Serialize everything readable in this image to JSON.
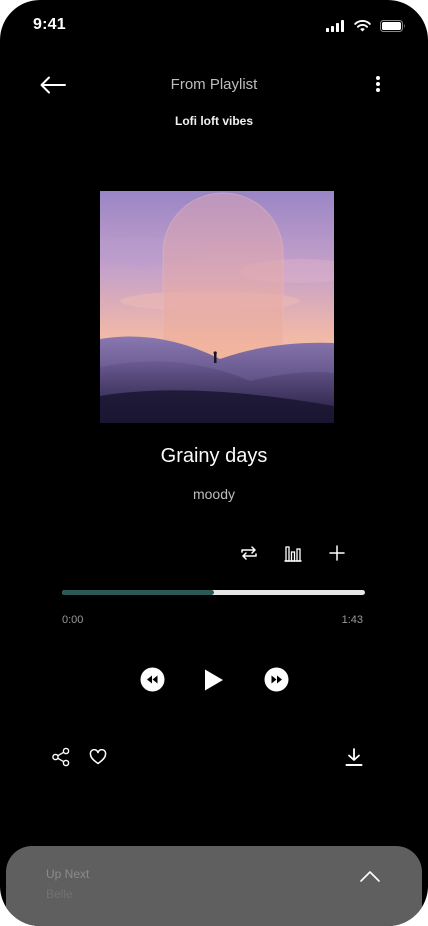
{
  "status_bar": {
    "time": "9:41",
    "icons": [
      "cellular-signal-icon",
      "wifi-icon",
      "battery-icon"
    ]
  },
  "header": {
    "back_icon": "arrow-left-icon",
    "title": "From Playlist",
    "menu_icon": "more-vertical-icon"
  },
  "playlist": {
    "name": "Lofi loft vibes"
  },
  "track": {
    "title": "Grainy days",
    "artist": "moody",
    "progress_fraction": 0.5,
    "elapsed": "0:00",
    "duration": "1:43"
  },
  "track_tools": [
    "repeat-icon",
    "equalizer-icon",
    "add-icon"
  ],
  "playback_controls": [
    "rewind-icon",
    "play-icon",
    "fast-forward-icon"
  ],
  "actions": [
    "share-icon",
    "heart-icon",
    "download-icon"
  ],
  "up_next": {
    "label": "Up Next",
    "song": "Belle",
    "icon": "chevron-up-icon"
  },
  "colors": {
    "background": "#000000",
    "progress_fill": "#2b5a56",
    "progress_track": "#e6e6e6",
    "panel": "#5f5f5f"
  }
}
